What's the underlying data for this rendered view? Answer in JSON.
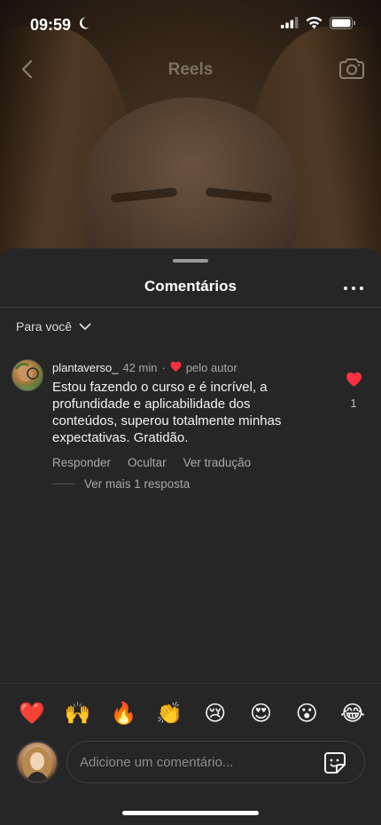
{
  "status_bar": {
    "time": "09:59",
    "icons": [
      "moon-icon",
      "signal-icon",
      "wifi-icon",
      "battery-icon"
    ]
  },
  "reels_nav": {
    "title": "Reels",
    "back_icon": "back-arrow-icon",
    "camera_icon": "camera-icon"
  },
  "sheet": {
    "title": "Comentários",
    "more_icon": "more-icon",
    "filter_label": "Para você"
  },
  "comment": {
    "username": "plantaverso_",
    "time_ago": "42 min",
    "separator": "·",
    "liked_by_author": "pelo autor",
    "text": "Estou fazendo o curso e é  incrível,  a profundidade e aplicabilidade dos conteúdos,  superou totalmente minhas expectativas.  Gratidão.",
    "actions": [
      "Responder",
      "Ocultar",
      "Ver tradução"
    ],
    "like_count": "1",
    "replies_label": "Ver mais 1 resposta"
  },
  "emoji_bar": [
    "❤️",
    "🙌",
    "🔥",
    "👏",
    "😢",
    "😍",
    "😮",
    "😂"
  ],
  "comment_input": {
    "placeholder": "Adicione um comentário..."
  },
  "colors": {
    "sheet_bg": "#262626",
    "like_red": "#ff3040",
    "muted_text": "#a8a8a8"
  }
}
